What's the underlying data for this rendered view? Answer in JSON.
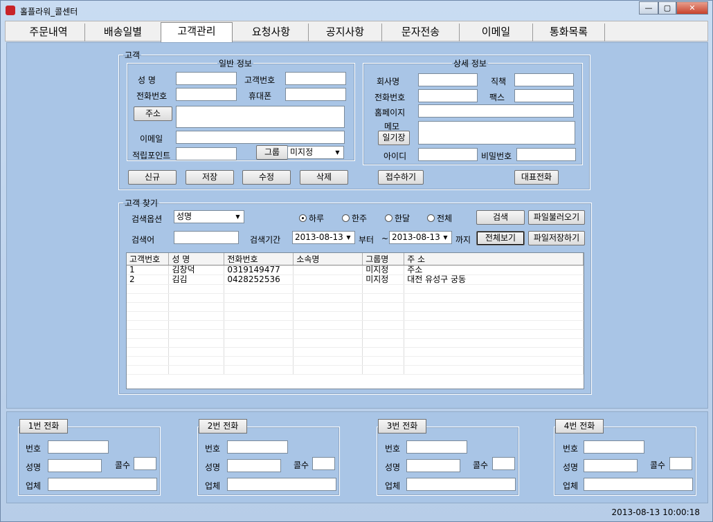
{
  "window": {
    "title": "홀플라워_콜센터",
    "min": "—",
    "max": "▢",
    "close": "✕"
  },
  "tabs": [
    "주문내역",
    "배송일별",
    "고객관리",
    "요청사항",
    "공지사항",
    "문자전송",
    "이메일",
    "통화목록"
  ],
  "active_tab": "고객관리",
  "customer": {
    "group_label": "고객",
    "general": {
      "legend": "일반 정보",
      "name_label": "성    명",
      "customer_no_label": "고객번호",
      "phone_label": "전화번호",
      "mobile_label": "휴대폰",
      "address_button": "주소",
      "email_label": "이메일",
      "points_label": "적립포인트",
      "group_button": "그룹",
      "group_value": "미지정"
    },
    "detail": {
      "legend": "상세 정보",
      "company_label": "회사명",
      "position_label": "직책",
      "phone_label": "전화번호",
      "fax_label": "팩스",
      "homepage_label": "홈페이지",
      "memo_label": "메모",
      "diary_button": "일기장",
      "id_label": "아이디",
      "password_label": "비밀번호"
    },
    "buttons": {
      "new": "신규",
      "save": "저장",
      "edit": "수정",
      "delete": "삭제",
      "receive": "접수하기",
      "main_phone": "대표전화"
    }
  },
  "search": {
    "group_label": "고객 찾기",
    "option_label": "검색옵션",
    "option_value": "성명",
    "radios": [
      "하루",
      "한주",
      "한달",
      "전체"
    ],
    "selected_radio": "하루",
    "search_button": "검색",
    "load_file_button": "파일불러오기",
    "keyword_label": "검색어",
    "period_label": "검색기간",
    "date_from": "2013-08-13",
    "from_suffix": "부터",
    "tilde": "~",
    "date_to": "2013-08-13",
    "to_suffix": "까지",
    "view_all_button": "전체보기",
    "save_file_button": "파일저장하기"
  },
  "grid": {
    "columns": [
      "고객번호",
      "성 명",
      "전화번호",
      "소속명",
      "그룹명",
      "주 소"
    ],
    "rows": [
      [
        "1",
        "김창덕",
        "0319149477",
        "",
        "미지정",
        "주소"
      ],
      [
        "2",
        "김김",
        "0428252536",
        "",
        "미지정",
        "대전 유성구 궁동"
      ]
    ]
  },
  "phones": [
    {
      "title": "1번 전화",
      "no_label": "번호",
      "name_label": "성명",
      "calls_label": "콜수",
      "company_label": "업체"
    },
    {
      "title": "2번 전화",
      "no_label": "번호",
      "name_label": "성명",
      "calls_label": "콜수",
      "company_label": "업체"
    },
    {
      "title": "3번 전화",
      "no_label": "번호",
      "name_label": "성명",
      "calls_label": "콜수",
      "company_label": "업체"
    },
    {
      "title": "4번 전화",
      "no_label": "번호",
      "name_label": "성명",
      "calls_label": "콜수",
      "company_label": "업체"
    }
  ],
  "status": {
    "datetime": "2013-08-13 10:00:18"
  }
}
